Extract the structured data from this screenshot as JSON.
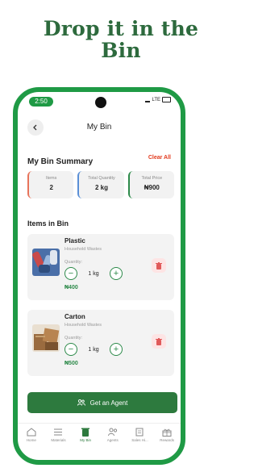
{
  "headline": {
    "line1": "Drop it in the",
    "line2": "Bin"
  },
  "status": {
    "time": "2:50",
    "network": "LTE"
  },
  "nav": {
    "title": "My Bin"
  },
  "summary": {
    "title": "My Bin Summary",
    "clear_label": "Clear All",
    "cards": [
      {
        "label": "Items",
        "value": "2",
        "accent": "#e8735a"
      },
      {
        "label": "Total Quantity",
        "value": "2 kg",
        "accent": "#5a8fd6"
      },
      {
        "label": "Total Price",
        "value": "₦900",
        "accent": "#2d8a4a"
      }
    ]
  },
  "items_section": {
    "title": "Items in Bin"
  },
  "items": [
    {
      "name": "Plastic",
      "category": "Household Wastes",
      "qty_label": "Quantity:",
      "qty": "1 kg",
      "price": "₦400",
      "thumb_icon": "plastic-bottles-photo"
    },
    {
      "name": "Carton",
      "category": "Household Wastes",
      "qty_label": "Quantity:",
      "qty": "1 kg",
      "price": "₦500",
      "thumb_icon": "carton-boxes-photo"
    }
  ],
  "cta": {
    "label": "Get an Agent",
    "icon": "agent-icon"
  },
  "tabs": [
    {
      "label": "Home",
      "icon": "home-icon"
    },
    {
      "label": "Materials",
      "icon": "list-icon"
    },
    {
      "label": "My Bin",
      "icon": "bin-icon",
      "active": true
    },
    {
      "label": "Agents",
      "icon": "users-icon"
    },
    {
      "label": "Sales Hi...",
      "icon": "receipt-icon"
    },
    {
      "label": "Rewards",
      "icon": "gift-icon"
    }
  ],
  "colors": {
    "brand": "#2d7a3e",
    "frame": "#1f9a45",
    "danger": "#e23a1d"
  }
}
